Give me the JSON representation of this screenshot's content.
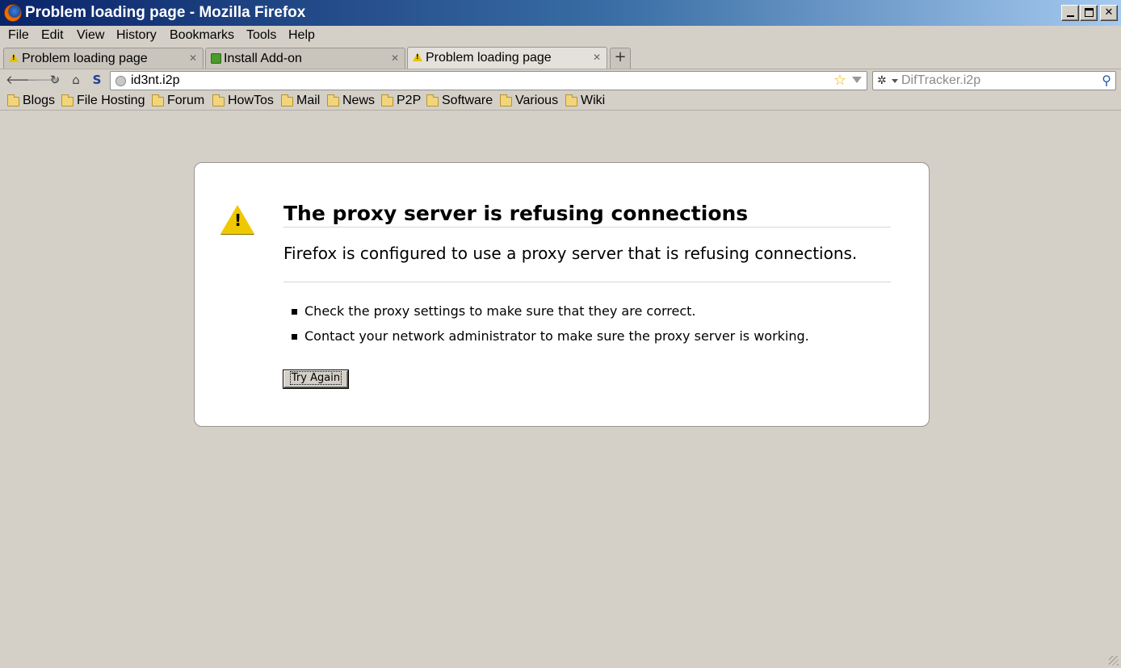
{
  "window": {
    "title": "Problem loading page - Mozilla Firefox"
  },
  "menu": {
    "items": [
      "File",
      "Edit",
      "View",
      "History",
      "Bookmarks",
      "Tools",
      "Help"
    ]
  },
  "tabs": [
    {
      "label": "Problem loading page",
      "icon": "warning-icon",
      "active": false
    },
    {
      "label": "Install Add-on",
      "icon": "addon-icon",
      "active": false
    },
    {
      "label": "Problem loading page",
      "icon": "warning-icon",
      "active": true
    }
  ],
  "navbar": {
    "url": "id3nt.i2p",
    "search_placeholder": "DifTracker.i2p"
  },
  "bookmarks": [
    "Blogs",
    "File Hosting",
    "Forum",
    "HowTos",
    "Mail",
    "News",
    "P2P",
    "Software",
    "Various",
    "Wiki"
  ],
  "error": {
    "title": "The proxy server is refusing connections",
    "description": "Firefox is configured to use a proxy server that is refusing connections.",
    "bullets": [
      "Check the proxy settings to make sure that they are correct.",
      "Contact your network administrator to make sure the proxy server is working."
    ],
    "button_label": "Try Again"
  }
}
